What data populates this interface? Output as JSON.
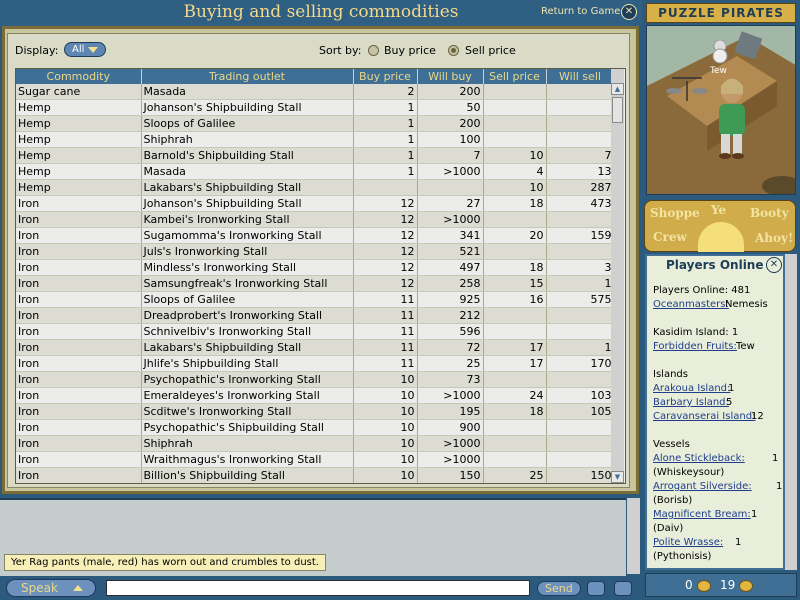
{
  "window": {
    "title": "Buying and selling commodities",
    "return_link": "Return to Game"
  },
  "controls": {
    "display_label": "Display:",
    "display_value": "All",
    "sortby_label": "Sort by:",
    "sort_buy_label": "Buy price",
    "sort_sell_label": "Sell price",
    "sort_selected": "Sell price"
  },
  "table": {
    "headers": [
      "Commodity",
      "Trading outlet",
      "Buy price",
      "Will buy",
      "Sell price",
      "Will sell"
    ],
    "rows": [
      [
        "Sugar cane",
        "Masada",
        "2",
        "200",
        "",
        ""
      ],
      [
        "Hemp",
        "Johanson's Shipbuilding Stall",
        "1",
        "50",
        "",
        ""
      ],
      [
        "Hemp",
        "Sloops of Galilee",
        "1",
        "200",
        "",
        ""
      ],
      [
        "Hemp",
        "Shiphrah",
        "1",
        "100",
        "",
        ""
      ],
      [
        "Hemp",
        "Barnold's Shipbuilding Stall",
        "1",
        "7",
        "10",
        "7"
      ],
      [
        "Hemp",
        "Masada",
        "1",
        ">1000",
        "4",
        "13"
      ],
      [
        "Hemp",
        "Lakabars's Shipbuilding Stall",
        "",
        "",
        "10",
        "287"
      ],
      [
        "Iron",
        "Johanson's Shipbuilding Stall",
        "12",
        "27",
        "18",
        "473"
      ],
      [
        "Iron",
        "Kambei's Ironworking Stall",
        "12",
        ">1000",
        "",
        ""
      ],
      [
        "Iron",
        "Sugamomma's Ironworking Stall",
        "12",
        "341",
        "20",
        "159"
      ],
      [
        "Iron",
        "Juls's Ironworking Stall",
        "12",
        "521",
        "",
        ""
      ],
      [
        "Iron",
        "Mindless's Ironworking Stall",
        "12",
        "497",
        "18",
        "3"
      ],
      [
        "Iron",
        "Samsungfreak's Ironworking Stall",
        "12",
        "258",
        "15",
        "1"
      ],
      [
        "Iron",
        "Sloops of Galilee",
        "11",
        "925",
        "16",
        "575"
      ],
      [
        "Iron",
        "Dreadprobert's Ironworking Stall",
        "11",
        "212",
        "",
        ""
      ],
      [
        "Iron",
        "Schnivelbiv's Ironworking Stall",
        "11",
        "596",
        "",
        ""
      ],
      [
        "Iron",
        "Lakabars's Shipbuilding Stall",
        "11",
        "72",
        "17",
        "1"
      ],
      [
        "Iron",
        "Jhlife's Shipbuilding Stall",
        "11",
        "25",
        "17",
        "170"
      ],
      [
        "Iron",
        "Psychopathic's Ironworking Stall",
        "10",
        "73",
        "",
        ""
      ],
      [
        "Iron",
        "Emeraldeyes's Ironworking Stall",
        "10",
        ">1000",
        "24",
        "103"
      ],
      [
        "Iron",
        "Scditwe's Ironworking Stall",
        "10",
        "195",
        "18",
        "105"
      ],
      [
        "Iron",
        "Psychopathic's Shipbuilding Stall",
        "10",
        "900",
        "",
        ""
      ],
      [
        "Iron",
        "Shiphrah",
        "10",
        ">1000",
        "",
        ""
      ],
      [
        "Iron",
        "Wraithmagus's Ironworking Stall",
        "10",
        ">1000",
        "",
        ""
      ],
      [
        "Iron",
        "Billion's Shipbuilding Stall",
        "10",
        "150",
        "25",
        "150"
      ]
    ]
  },
  "chat": {
    "message": "Yer Rag pants (male, red) has worn out and crumbles to dust.",
    "speak_label": "Speak",
    "input_value": "",
    "send_label": "Send"
  },
  "sidebar": {
    "logo": "PUZZLE PIRATES",
    "character_name": "Tew",
    "tabs": [
      "Shoppe",
      "Ye",
      "Booty",
      "Crew",
      "Ahoy!"
    ],
    "players_panel": {
      "title": "Players Online",
      "players_online": "Players Online: 481",
      "oceanmasters_label": "Oceanmasters:",
      "oceanmasters_value": "Nemesis",
      "island_line": "Kasidim Island: 1",
      "forbidden_label": "Forbidden Fruits:",
      "forbidden_value": "Tew",
      "islands_heading": "Islands",
      "islands": [
        {
          "name": "Arakoua Island:",
          "count": "1"
        },
        {
          "name": "Barbary Island:",
          "count": "5"
        },
        {
          "name": "Caravanserai Island:",
          "count": "12"
        }
      ],
      "vessels_heading": "Vessels",
      "vessels": [
        {
          "name": "Alone Stickleback:",
          "count": "1",
          "owner": "(Whiskeysour)"
        },
        {
          "name": "Arrogant Silverside:",
          "count": "1",
          "owner": "(Borisb)"
        },
        {
          "name": "Magnificent Bream:",
          "count": "1",
          "owner": "(Daiv)"
        },
        {
          "name": "Polite Wrasse:",
          "count": "1",
          "owner": "(Pythonisis)"
        }
      ]
    },
    "status": {
      "gold": "0",
      "doubloons": "19"
    }
  },
  "colors": {
    "header_bg": "#3f6f94",
    "header_text": "#e9d889",
    "frame_gold": "#d0ad4a"
  }
}
